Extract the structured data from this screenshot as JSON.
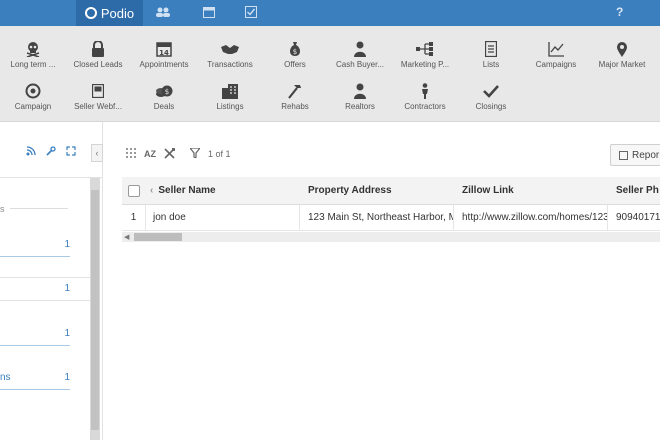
{
  "topbar": {
    "brand": "Podio",
    "help": "?"
  },
  "apps_row1": [
    {
      "label": "Long term ...",
      "icon": "skull-icon",
      "glyph": "☠"
    },
    {
      "label": "Closed Leads",
      "icon": "lock-icon",
      "glyph": "🔒"
    },
    {
      "label": "Appointments",
      "icon": "calendar-icon",
      "glyph": "14"
    },
    {
      "label": "Transactions",
      "icon": "handshake-icon",
      "glyph": "🤝"
    },
    {
      "label": "Offers",
      "icon": "money-bag-icon",
      "glyph": "💰"
    },
    {
      "label": "Cash Buyer...",
      "icon": "person-icon",
      "glyph": "👤"
    },
    {
      "label": "Marketing P...",
      "icon": "flow-icon",
      "glyph": "⊰"
    },
    {
      "label": "Lists",
      "icon": "list-icon",
      "glyph": "▤"
    },
    {
      "label": "Campaigns",
      "icon": "chart-icon",
      "glyph": "📈"
    },
    {
      "label": "Major Market",
      "icon": "map-pin-icon",
      "glyph": "📍"
    }
  ],
  "apps_row2": [
    {
      "label": "Campaign",
      "icon": "target-icon",
      "glyph": "◎"
    },
    {
      "label": "Seller Webf...",
      "icon": "form-icon",
      "glyph": "▣"
    },
    {
      "label": "Deals",
      "icon": "coins-icon",
      "glyph": "⊜"
    },
    {
      "label": "Listings",
      "icon": "buildings-icon",
      "glyph": "🏢"
    },
    {
      "label": "Rehabs",
      "icon": "hammer-icon",
      "glyph": "🔨"
    },
    {
      "label": "Realtors",
      "icon": "person-icon",
      "glyph": "👤"
    },
    {
      "label": "Contractors",
      "icon": "worker-icon",
      "glyph": "🚶"
    },
    {
      "label": "Closings",
      "icon": "check-icon",
      "glyph": "✔"
    }
  ],
  "leftpanel": {
    "label_s": "s",
    "rows": [
      {
        "name": "",
        "count": "1"
      },
      {
        "name": "",
        "count": "1"
      },
      {
        "name": "",
        "count": "1"
      },
      {
        "name": "ns",
        "count": "1"
      }
    ]
  },
  "toolbar": {
    "az": "AZ",
    "filter_count": "1 of 1",
    "report_label": "Repor"
  },
  "table": {
    "columns": [
      "Seller Name",
      "Property Address",
      "Zillow Link",
      "Seller Ph"
    ],
    "rows": [
      {
        "num": "1",
        "seller_name": "jon doe",
        "property_address": "123 Main St, Northeast Harbor, M",
        "zillow_link": "http://www.zillow.com/homes/123",
        "seller_phone": "90940171"
      }
    ]
  }
}
